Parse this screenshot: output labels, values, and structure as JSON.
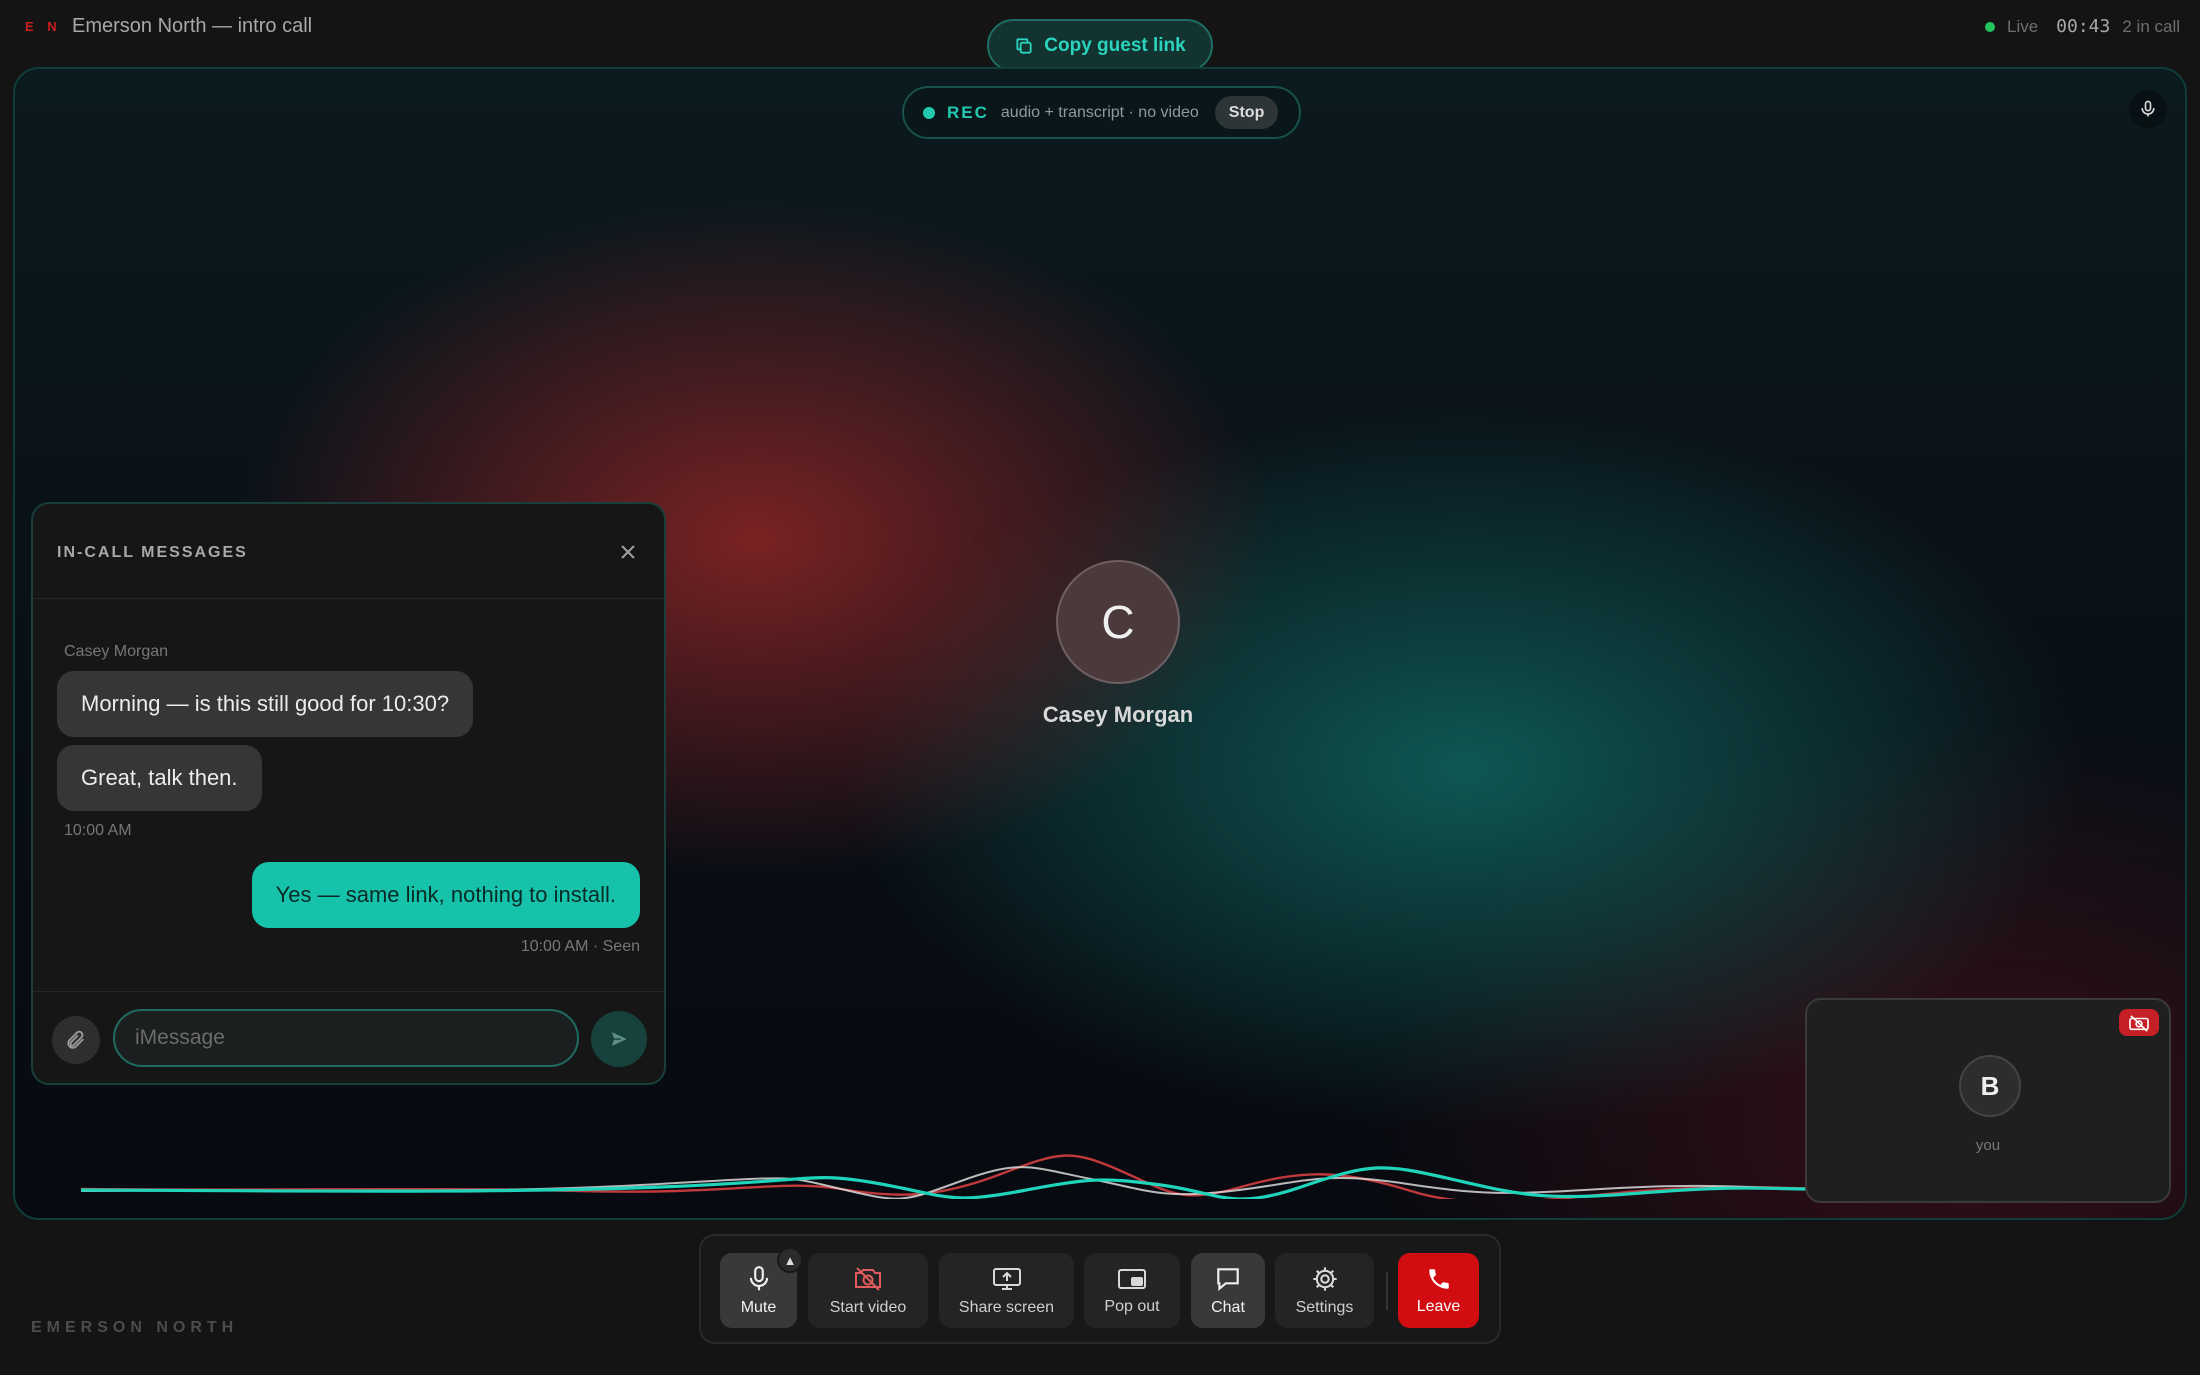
{
  "topbar": {
    "brand_mark": "E N",
    "call_title": "Emerson North — intro call",
    "copy_link_label": "Copy guest link",
    "status_live": "Live",
    "timer": "00:43",
    "participants": "2 in call"
  },
  "recording": {
    "label": "REC",
    "detail": "audio + transcript · no video",
    "stop_label": "Stop"
  },
  "speaker": {
    "initial": "C",
    "name": "Casey Morgan"
  },
  "self_view": {
    "initial": "B",
    "label": "you"
  },
  "chat": {
    "title": "IN-CALL MESSAGES",
    "sender": "Casey Morgan",
    "messages": [
      {
        "text": "Morning — is this still good for 10:30?"
      },
      {
        "text": "Great, talk then."
      },
      {
        "text": "Yes — same link, nothing to install."
      }
    ],
    "timestamp_in": "10:00 AM",
    "timestamp_out": "10:00 AM · Seen",
    "input_placeholder": "iMessage"
  },
  "controls": {
    "mute": "Mute",
    "start_video": "Start video",
    "share_screen": "Share screen",
    "pop_out": "Pop out",
    "chat": "Chat",
    "settings": "Settings",
    "leave": "Leave"
  },
  "footer_brand": "EMERSON NORTH",
  "colors": {
    "accent": "#16c3aa",
    "record": "#22c9b0",
    "danger": "#d10d12",
    "live": "#22c55e"
  }
}
